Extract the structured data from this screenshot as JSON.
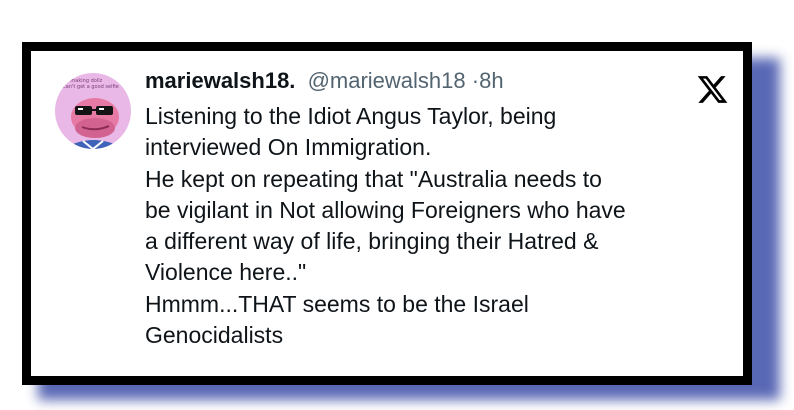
{
  "tweet": {
    "display_name": "mariewalsh18.",
    "handle": "@mariewalsh18",
    "separator": "·",
    "time": "8h",
    "lines": [
      "Listening to the Idiot Angus Taylor,  being",
      "interviewed On Immigration.",
      "He kept on repeating that \"Australia needs to",
      "be vigilant in Not allowing Foreigners who have",
      "a different way of life, bringing their Hatred &",
      "Violence here..\"",
      "Hmmm...THAT seems to be the Israel",
      "Genocidalists"
    ]
  },
  "avatar": {
    "text_line_1": "lol making dollz",
    "text_line_2": "can't get a good selfie"
  },
  "icons": {
    "platform_logo": "x-logo-icon"
  },
  "colors": {
    "frame": "#000000",
    "shadow": "#3d4ea8",
    "text_primary": "#0f1419",
    "text_secondary": "#536471",
    "avatar_bg": "#e9b8e6"
  }
}
